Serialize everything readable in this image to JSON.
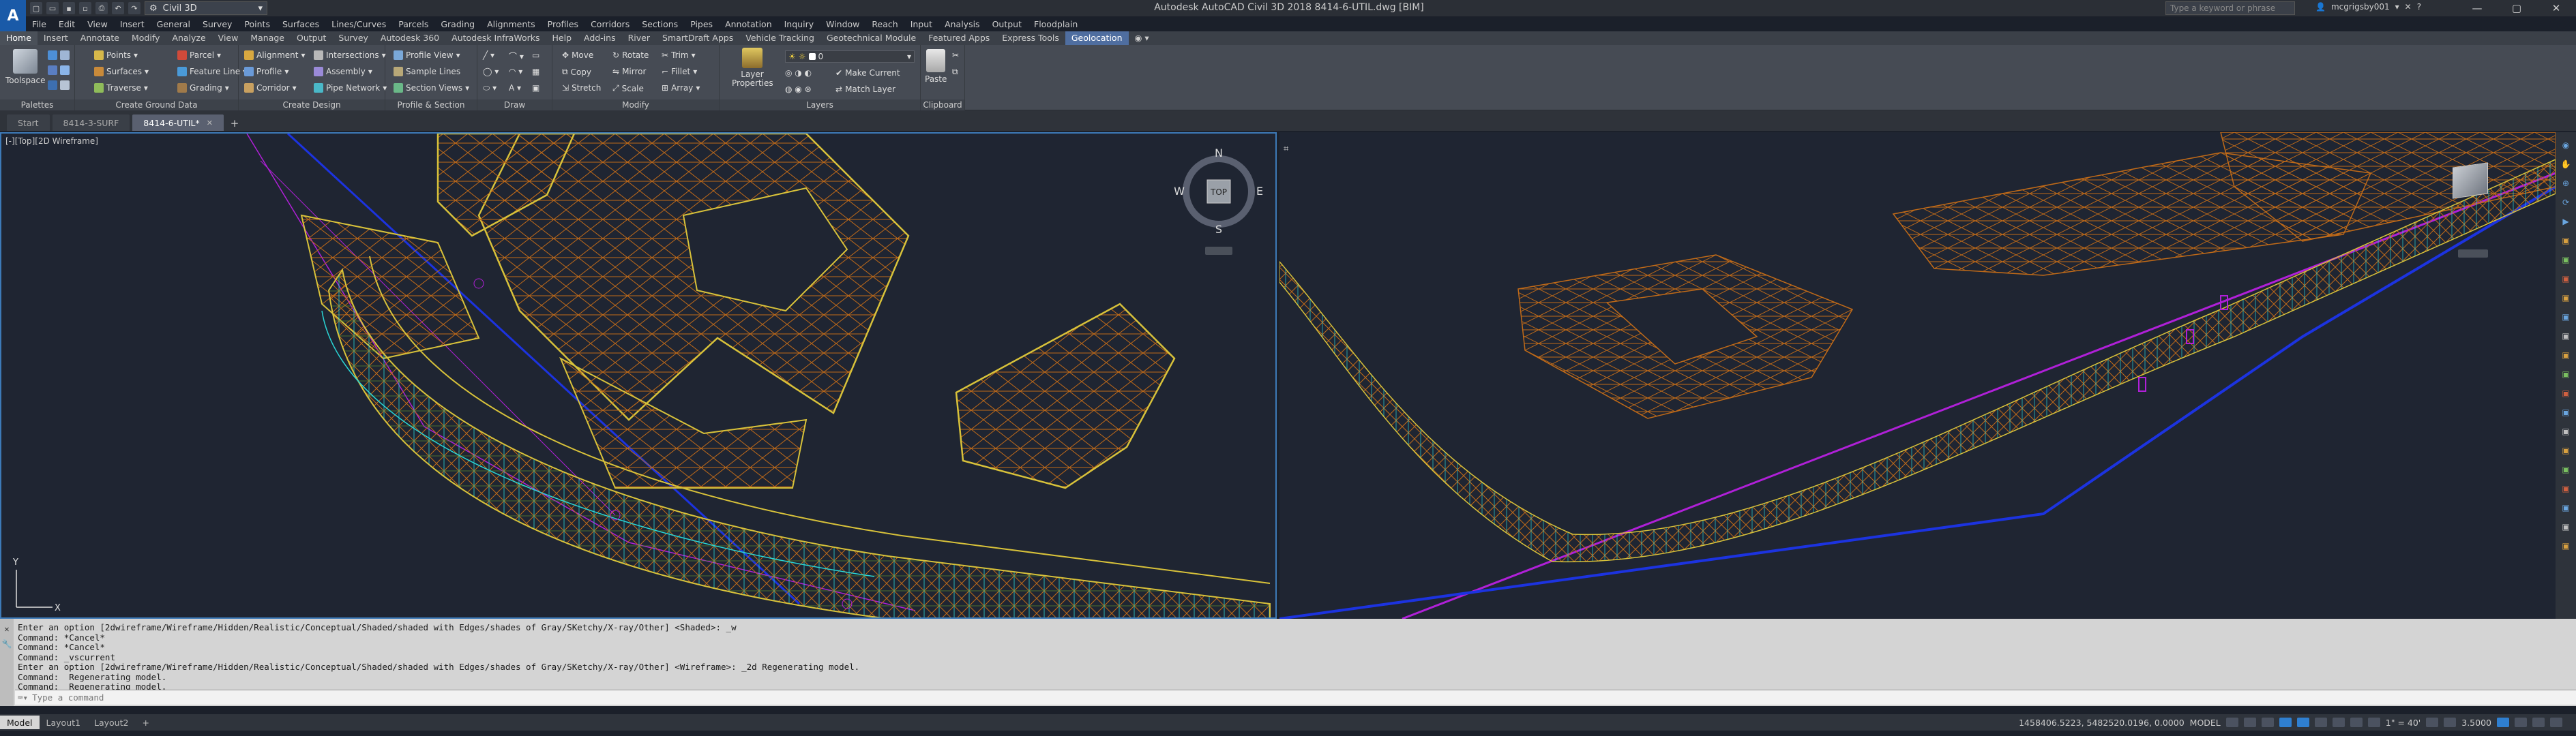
{
  "app": {
    "logo": "A",
    "window_title": "Autodesk AutoCAD Civil 3D 2018   8414-6-UTIL.dwg [BIM]"
  },
  "qat": {
    "workspace": "Civil 3D",
    "icons": [
      "new-icon",
      "open-icon",
      "save-icon",
      "save-as-icon",
      "print-icon",
      "undo-icon",
      "redo-icon"
    ]
  },
  "search": {
    "placeholder": "Type a keyword or phrase"
  },
  "user": {
    "name": "mcgrigsby001",
    "sign_in_icon": "user-icon"
  },
  "menu": [
    "File",
    "Edit",
    "View",
    "Insert",
    "General",
    "Survey",
    "Points",
    "Surfaces",
    "Lines/Curves",
    "Parcels",
    "Grading",
    "Alignments",
    "Profiles",
    "Corridors",
    "Sections",
    "Pipes",
    "Annotation",
    "Inquiry",
    "Window",
    "Reach",
    "Input",
    "Analysis",
    "Output",
    "Floodplain"
  ],
  "ribbon_tabs": [
    "Home",
    "Insert",
    "Annotate",
    "Modify",
    "Analyze",
    "View",
    "Manage",
    "Output",
    "Survey",
    "Autodesk 360",
    "Autodesk InfraWorks",
    "Help",
    "Add-ins",
    "River",
    "SmartDraft Apps",
    "Vehicle Tracking",
    "Geotechnical Module",
    "Featured Apps",
    "Express Tools",
    "Geolocation"
  ],
  "ribbon": {
    "palettes": {
      "toolspace": "Toolspace",
      "title": "Palettes"
    },
    "ground": {
      "points": "Points",
      "surfaces": "Surfaces",
      "traverse": "Traverse",
      "parcel": "Parcel",
      "feature_line": "Feature Line",
      "grading": "Grading",
      "title": "Create Ground Data"
    },
    "design": {
      "alignment": "Alignment",
      "profile": "Profile",
      "corridor": "Corridor",
      "intersections": "Intersections",
      "assembly": "Assembly",
      "pipe_network": "Pipe Network",
      "title": "Create Design"
    },
    "profile_section": {
      "profile_view": "Profile View",
      "sample_lines": "Sample Lines",
      "section_views": "Section Views",
      "title": "Profile & Section Views"
    },
    "draw": {
      "title": "Draw"
    },
    "modify": {
      "move": "Move",
      "rotate": "Rotate",
      "trim": "Trim",
      "copy": "Copy",
      "mirror": "Mirror",
      "fillet": "Fillet",
      "stretch": "Stretch",
      "scale": "Scale",
      "array": "Array",
      "title": "Modify"
    },
    "layers": {
      "layer_properties": "Layer Properties",
      "current_layer": "0",
      "make_current": "Make Current",
      "match_layer": "Match Layer",
      "title": "Layers"
    },
    "clipboard": {
      "paste": "Paste",
      "title": "Clipboard"
    }
  },
  "doc_tabs": [
    {
      "label": "Start",
      "active": false
    },
    {
      "label": "8414-3-SURF",
      "active": false
    },
    {
      "label": "8414-6-UTIL*",
      "active": true
    }
  ],
  "viewports": {
    "left_label": "[-][Top][2D Wireframe]",
    "compass": {
      "n": "N",
      "s": "S",
      "e": "E",
      "w": "W",
      "face": "TOP"
    },
    "ucs_x": "X",
    "ucs_y": "Y"
  },
  "command_history": [
    "Enter an option [2dwireframe/Wireframe/Hidden/Realistic/Conceptual/Shaded/shaded with Edges/shades of Gray/SKetchy/X-ray/Other] <Shaded>: _w",
    "Command: *Cancel*",
    "Command: *Cancel*",
    "Command: _vscurrent",
    "Enter an option [2dwireframe/Wireframe/Hidden/Realistic/Conceptual/Shaded/shaded with Edges/shades of Gray/SKetchy/X-ray/Other] <Wireframe>: _2d Regenerating model.",
    "Command:  Regenerating model.",
    "Command:  Regenerating model."
  ],
  "command_prompt": {
    "placeholder": "Type a command"
  },
  "layout_tabs": [
    {
      "label": "Model",
      "active": true
    },
    {
      "label": "Layout1",
      "active": false
    },
    {
      "label": "Layout2",
      "active": false
    }
  ],
  "status": {
    "coords": "1458406.5223, 5482520.0196, 0.0000",
    "space": "MODEL",
    "scale": "1\" = 40'",
    "value": "3.5000"
  },
  "colors": {
    "accent": "#3d7ab8",
    "yellow": "#d8c23a",
    "brown": "#c06a18",
    "blue": "#1c33e0",
    "magenta": "#b020d8",
    "cyan": "#2ad6d6"
  }
}
